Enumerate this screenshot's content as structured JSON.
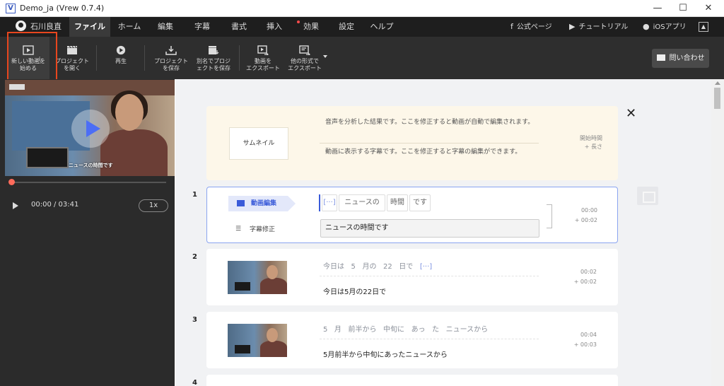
{
  "window": {
    "title": "Demo_ja (Vrew 0.7.4)",
    "icon_letter": "V",
    "minimize": "—",
    "maximize": "☐",
    "close": "✕"
  },
  "menubar": {
    "user": "石川良直",
    "items": [
      "ファイル",
      "ホーム",
      "編集",
      "字幕",
      "書式",
      "挿入",
      "効果",
      "設定",
      "ヘルプ"
    ],
    "active": "ファイル",
    "links": [
      "公式ページ",
      "チュートリアル",
      "iOSアプリ"
    ]
  },
  "toolbar": {
    "new_project": "新しい動画を\n始める",
    "open_project": "プロジェクト\nを開く",
    "play": "再生",
    "save_project": "プロジェクト\nを保存",
    "save_as": "別名でプロジ\nェクトを保存",
    "export_video": "動画を\nエクスポート",
    "export_other": "他の形式で\nエクスポート",
    "contact": "問い合わせ"
  },
  "player": {
    "caption": "ニュースの時間です",
    "time": "00:00 / 03:41",
    "speed": "1x",
    "progress": 0.0
  },
  "guide": {
    "thumbnail_label": "サムネイル",
    "text1": "音声を分析した結果です。ここを修正すると動画が自動で編集されます。",
    "text2": "動画に表示する字幕です。ここを修正すると字幕の編集ができます。",
    "time_label": "開始時間",
    "length_label": "+ 長さ"
  },
  "clips": [
    {
      "num": "1",
      "video_edit_label": "動画編集",
      "sub_edit_label": "字幕修正",
      "words": [
        "[···]",
        "ニュースの",
        "時間",
        "です"
      ],
      "subtitle": "ニュースの時間です",
      "start": "00:00",
      "length": "+ 00:02"
    },
    {
      "num": "2",
      "words": [
        "今日は",
        "5",
        "月の",
        "22",
        "日で",
        "[···]"
      ],
      "subtitle": "今日は5月の22日で",
      "start": "00:02",
      "length": "+ 00:02"
    },
    {
      "num": "3",
      "words": [
        "5",
        "月",
        "前半から",
        "中旬に",
        "あっ",
        "た",
        "ニュースから"
      ],
      "subtitle": "5月前半から中旬にあったニュースから",
      "start": "00:04",
      "length": "+ 00:03"
    },
    {
      "num": "4"
    }
  ],
  "colors": {
    "accent": "#3a5bd9",
    "highlight_box": "#e8461e",
    "guide_bg": "#fdf7e9"
  }
}
